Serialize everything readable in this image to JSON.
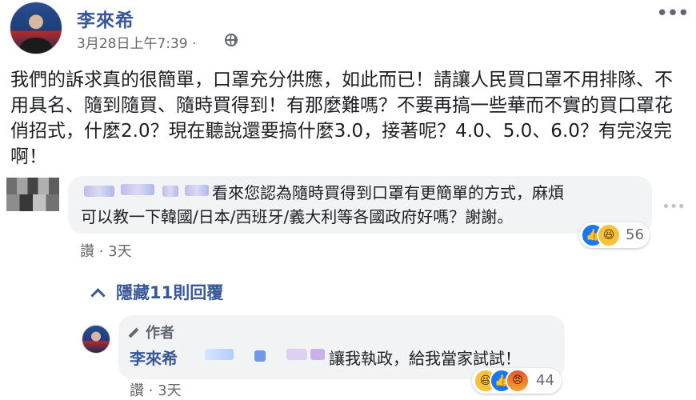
{
  "post": {
    "author": "李來希",
    "meta": "3月28日上午7:39 ·",
    "more": "•••",
    "body": "我們的訴求真的很簡單，口罩充分供應，如此而已！請讓人民買口罩不用排隊、不用具名、隨到隨買、隨時買得到！有那麼難嗎？不要再搞一些華而不實的買口罩花俏招式，什麼2.0？現在聽說還要搞什麼3.0，接著呢？4.0、5.0、6.0？有完沒完啊！"
  },
  "comment": {
    "text_line1": "看來您認為隨時買得到口罩有更簡單的方式，麻煩",
    "text_line2": "可以教一下韓國/日本/西班牙/義大利等各國政府好嗎？謝謝。",
    "reaction_count": "56",
    "actions": "讚 · 3天",
    "options": "•••"
  },
  "replies_toggle": "隱藏11則回覆",
  "reply": {
    "badge": "作者",
    "author": "李來希",
    "text": "讓我執政，給我當家試試！",
    "reaction_count": "44",
    "actions": "讚 · 3天"
  },
  "icons": {
    "like": "like-icon",
    "haha": "haha-icon",
    "angry": "angry-icon",
    "globe": "globe-icon",
    "pencil": "pencil-icon",
    "chevron": "chevron-up-icon"
  },
  "colors": {
    "link": "#385898",
    "bubble": "#f2f3f5",
    "meta": "#65676b",
    "like": "#1877f2"
  }
}
